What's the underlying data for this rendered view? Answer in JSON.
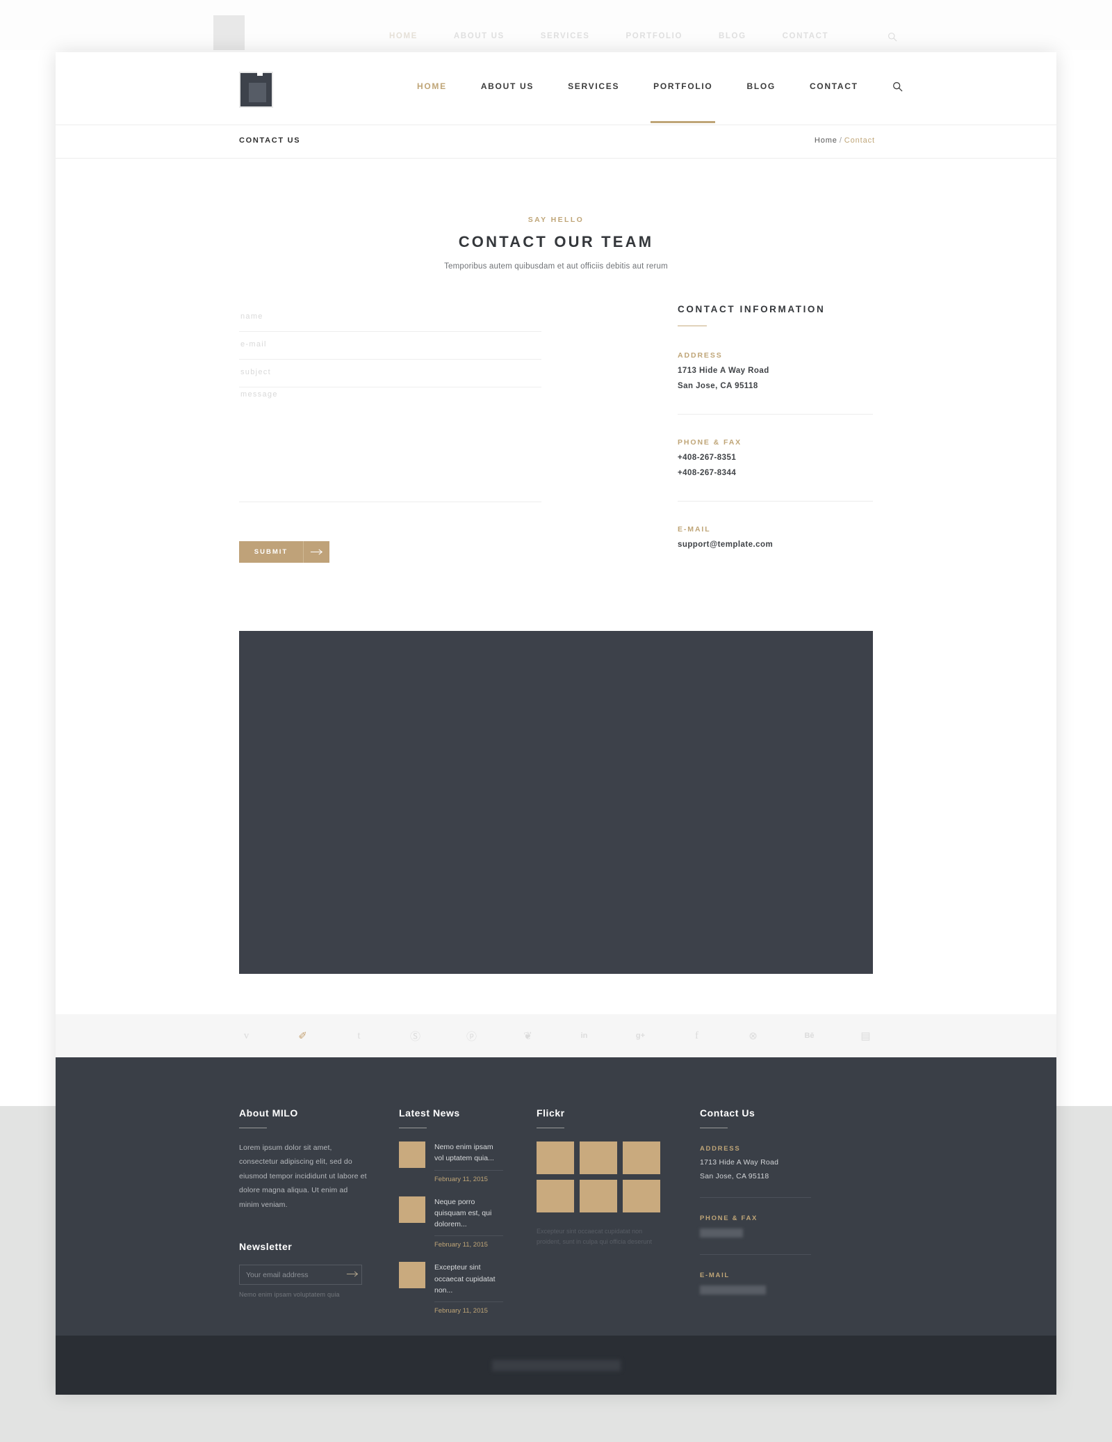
{
  "ghost_nav": {
    "items": [
      "HOME",
      "ABOUT US",
      "SERVICES",
      "PORTFOLIO",
      "BLOG",
      "CONTACT"
    ],
    "search_icon": "search-icon"
  },
  "header": {
    "logo_alt": "milo-logo",
    "nav": [
      {
        "label": "HOME",
        "active": true,
        "pill": false
      },
      {
        "label": "ABOUT US",
        "active": false,
        "pill": false
      },
      {
        "label": "SERVICES",
        "active": false,
        "pill": false
      },
      {
        "label": "PORTFOLIO",
        "active": false,
        "pill": true
      },
      {
        "label": "BLOG",
        "active": false,
        "pill": false
      },
      {
        "label": "CONTACT",
        "active": false,
        "pill": false
      }
    ],
    "search_icon": "search-icon"
  },
  "breadcrumb": {
    "title": "CONTACT US",
    "home": "Home",
    "separator": "/",
    "current": "Contact"
  },
  "heading": {
    "eyebrow": "SAY HELLO",
    "title": "CONTACT OUR TEAM",
    "subtitle": "Temporibus autem quibusdam et aut officiis debitis aut rerum"
  },
  "form": {
    "name_placeholder": "name",
    "name_value": "",
    "email_placeholder": "e-mail",
    "email_value": "",
    "subject_placeholder": "subject",
    "subject_value": "",
    "message_placeholder": "message",
    "message_value": "",
    "submit_label": "SUBMIT",
    "submit_arrow": "arrow-right-icon"
  },
  "contact_info": {
    "title": "CONTACT INFORMATION",
    "address_label": "ADDRESS",
    "address_line1": "1713 Hide A Way Road",
    "address_line2": "San Jose, CA 95118",
    "phone_label": "PHONE & FAX",
    "phone": "+408-267-8351",
    "fax": "+408-267-8344",
    "email_label": "E-MAIL",
    "email": "support@template.com"
  },
  "map": {
    "alt": "map-placeholder"
  },
  "social": [
    {
      "name": "vimeo-icon",
      "glyph": "v",
      "gold": false,
      "small": false
    },
    {
      "name": "twitter-icon",
      "glyph": "✐",
      "gold": true,
      "small": false
    },
    {
      "name": "tumblr-icon",
      "glyph": "t",
      "gold": false,
      "small": false
    },
    {
      "name": "skype-icon",
      "glyph": "Ⓢ",
      "gold": false,
      "small": false
    },
    {
      "name": "pinterest-icon",
      "glyph": "ⓟ",
      "gold": false,
      "small": false
    },
    {
      "name": "apple-icon",
      "glyph": "❦",
      "gold": false,
      "small": false
    },
    {
      "name": "linkedin-icon",
      "glyph": "in",
      "gold": false,
      "small": true
    },
    {
      "name": "google-plus-icon",
      "glyph": "g+",
      "gold": false,
      "small": true
    },
    {
      "name": "facebook-icon",
      "glyph": "f",
      "gold": false,
      "small": false
    },
    {
      "name": "dribbble-icon",
      "glyph": "⊗",
      "gold": false,
      "small": false
    },
    {
      "name": "behance-icon",
      "glyph": "Bē",
      "gold": false,
      "small": true
    },
    {
      "name": "youtube-icon",
      "glyph": "▤",
      "gold": false,
      "small": false
    }
  ],
  "footer": {
    "about": {
      "title": "About MILO",
      "text": "Lorem ipsum dolor sit amet, consectetur adipiscing elit, sed do eiusmod tempor incididunt ut labore et dolore magna aliqua. Ut enim ad minim veniam.",
      "newsletter_title": "Newsletter",
      "newsletter_placeholder": "Your email address",
      "newsletter_value": "",
      "newsletter_arrow": "arrow-right-icon",
      "newsletter_note": "Nemo enim ipsam voluptatem quia"
    },
    "news": {
      "title": "Latest News",
      "items": [
        {
          "title": "Nemo enim ipsam vol uptatem quia...",
          "date": "February 11, 2015"
        },
        {
          "title": "Neque porro quisquam est, qui dolorem...",
          "date": "February 11, 2015"
        },
        {
          "title": "Excepteur sint occaecat cupidatat non...",
          "date": "February 11, 2015"
        }
      ]
    },
    "flickr": {
      "title": "Flickr",
      "thumb_count": 6,
      "note": "Excepteur sint occaecat cupidatat non proident, sunt in culpa qui officia deserunt"
    },
    "contact": {
      "title": "Contact Us",
      "address_label": "ADDRESS",
      "address_line1": "1713 Hide A Way Road",
      "address_line2": "San Jose, CA 95118",
      "phone_label": "PHONE & FAX",
      "phone_redacted": true,
      "email_label": "E-MAIL",
      "email_redacted": true
    }
  },
  "bottom_bar": {
    "copyright_redacted": true
  },
  "colors": {
    "accent_gold": "#bfa577",
    "footer_bg": "#3a3f47",
    "bottom_bg": "#2a2e34",
    "thumb_tan": "#c9aa7e",
    "map_dark": "#3d414a"
  }
}
